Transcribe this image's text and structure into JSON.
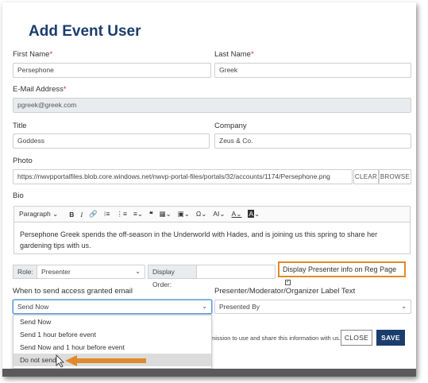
{
  "dialog": {
    "title": "Add Event User"
  },
  "fields": {
    "first_name": {
      "label": "First Name",
      "required_mark": "*",
      "value": "Persephone"
    },
    "last_name": {
      "label": "Last Name",
      "required_mark": "*",
      "value": "Greek"
    },
    "email": {
      "label": "E-Mail Address",
      "required_mark": "*",
      "value": "pgreek@greek.com"
    },
    "title": {
      "label": "Title",
      "value": "Goddess"
    },
    "company": {
      "label": "Company",
      "value": "Zeus & Co."
    },
    "photo": {
      "label": "Photo",
      "value": "https://nwvpportalfiles.blob.core.windows.net/nwvp-portal-files/portals/32/accounts/1174/Persephone.png",
      "clear_label": "CLEAR",
      "browse_label": "BROWSE"
    },
    "bio": {
      "label": "Bio",
      "text": "Persephone Greek spends the off-season in the Underworld with Hades, and is joining us this spring to share her gardening tips with us."
    }
  },
  "editor_toolbar": {
    "paragraph": "Paragraph",
    "bold": "B",
    "italic": "I",
    "font_size": "AI",
    "color": "A"
  },
  "role": {
    "label": "Role:",
    "value": "Presenter"
  },
  "display_order": {
    "label": "Display Order:",
    "value": ""
  },
  "display_presenter": {
    "label": "Display Presenter info on Reg Page",
    "checked": true,
    "check_mark": "✓"
  },
  "email_when": {
    "label": "When to send access granted email",
    "value": "Send Now",
    "options": [
      "Send Now",
      "Send 1 hour before event",
      "Send Now and 1 hour before event",
      "Do not send"
    ]
  },
  "label_text": {
    "label": "Presenter/Moderator/Organizer Label Text",
    "value": "Presented By"
  },
  "consent_fragment": "mission to use and share this information with us.",
  "buttons": {
    "close": "CLOSE",
    "save": "SAVE"
  },
  "colors": {
    "title": "#1b3d6d",
    "save": "#1b3d6d",
    "highlight": "#e08a2b",
    "arrow": "#e08a2b"
  }
}
